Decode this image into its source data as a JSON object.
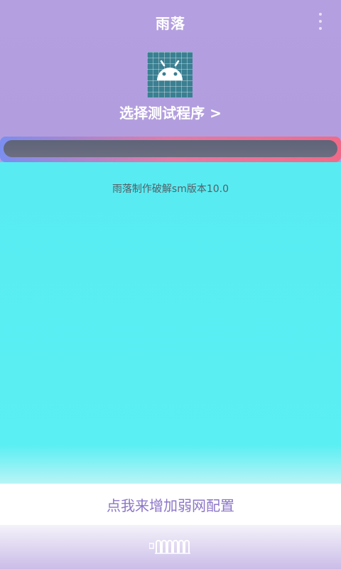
{
  "app": {
    "title": "雨落"
  },
  "header": {
    "select_program_label": "选择测试程序 >"
  },
  "progress": {
    "fraction": 0
  },
  "main": {
    "version_text": "雨落制作破解sm版本10.0"
  },
  "footer": {
    "button_label": "点我来增加弱网配置"
  },
  "colors": {
    "header_bg": "#b29fe0",
    "main_bg": "#58ecf2",
    "button_text": "#8c76c8"
  },
  "icons": {
    "menu": "more-vert-icon",
    "app": "android-icon",
    "nav": "home-handle-icon"
  }
}
